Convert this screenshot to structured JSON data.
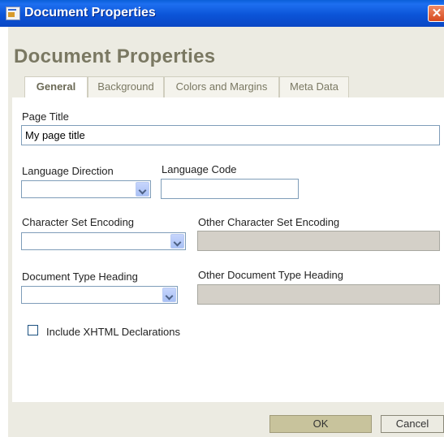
{
  "window": {
    "title": "Document Properties"
  },
  "heading": "Document Properties",
  "tabs": [
    {
      "label": "General",
      "active": true
    },
    {
      "label": "Background",
      "active": false
    },
    {
      "label": "Colors and Margins",
      "active": false
    },
    {
      "label": "Meta Data",
      "active": false
    }
  ],
  "form": {
    "page_title": {
      "label": "Page Title",
      "value": "My page title"
    },
    "language_direction": {
      "label": "Language Direction",
      "value": ""
    },
    "language_code": {
      "label": "Language Code",
      "value": ""
    },
    "charset": {
      "label": "Character Set Encoding",
      "value": ""
    },
    "other_charset": {
      "label": "Other Character Set Encoding",
      "value": ""
    },
    "doctype": {
      "label": "Document Type Heading",
      "value": ""
    },
    "other_doctype": {
      "label": "Other Document Type Heading",
      "value": ""
    },
    "xhtml": {
      "label": "Include XHTML Declarations",
      "checked": false
    }
  },
  "buttons": {
    "ok": "OK",
    "cancel": "Cancel"
  },
  "colors": {
    "titlebar": "#0b54d8",
    "panel": "#ecebe2",
    "ok_button": "#c8c39c"
  }
}
